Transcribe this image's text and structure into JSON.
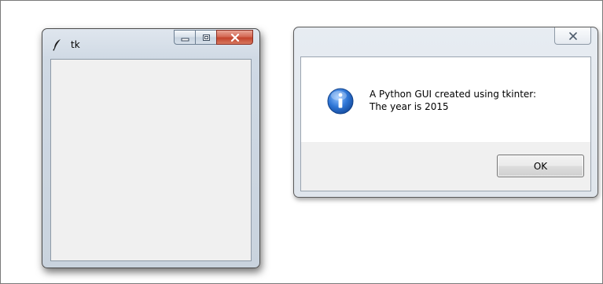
{
  "tk_window": {
    "title": "tk",
    "icon": "feather-icon",
    "controls": [
      "minimize-icon",
      "maximize-icon",
      "close-icon"
    ]
  },
  "dialog": {
    "icon": "info-icon",
    "message_line1": "A Python GUI created using tkinter:",
    "message_line2": "The year is 2015",
    "ok_label": "OK"
  },
  "colors": {
    "close_button_red": "#c3432c",
    "info_icon_blue": "#1f5fbf",
    "client_background": "#f0f0f0"
  }
}
